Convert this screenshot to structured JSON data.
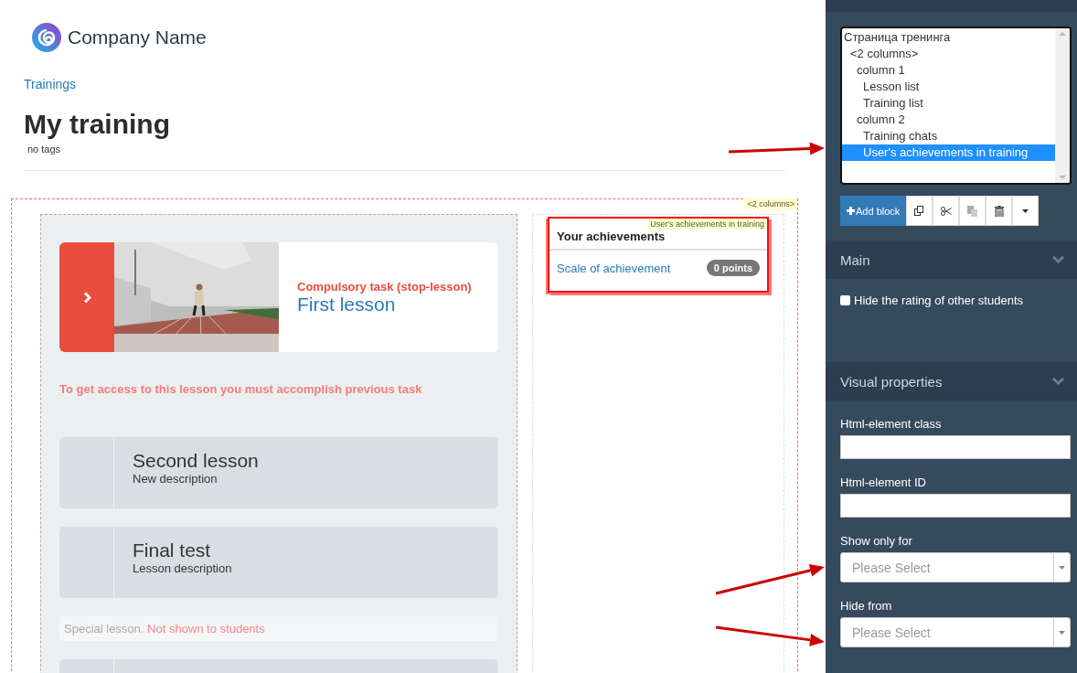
{
  "header": {
    "company": "Company Name",
    "breadcrumb": "Trainings",
    "title": "My training",
    "tags": "no tags"
  },
  "layout_tag": "<2 columns>",
  "column_1": {
    "featured": {
      "label": "Compulsory task (stop-lesson)",
      "title": "First lesson"
    },
    "notice": "To get access to this lesson you must accomplish previous task",
    "lessons": [
      {
        "kind": "card",
        "title": "Second lesson",
        "description": "New description"
      },
      {
        "kind": "card",
        "title": "Final test",
        "description": "Lesson description"
      },
      {
        "kind": "special",
        "text": "Special lesson.",
        "warning": "Not shown to students"
      },
      {
        "kind": "card"
      }
    ]
  },
  "column_2": {
    "widget": {
      "tag": "User's achievements in training",
      "title": "Your achievements",
      "link": "Scale of achievement",
      "badge": "0 points",
      "selected": true
    }
  },
  "sidebar": {
    "tree": [
      {
        "label": "Страница тренинга",
        "selected": false,
        "children": [
          {
            "label": "<2 columns>",
            "selected": false,
            "children": [
              {
                "label": "column 1",
                "selected": false,
                "children": [
                  {
                    "label": "Lesson list",
                    "selected": false
                  },
                  {
                    "label": "Training list",
                    "selected": false
                  }
                ]
              },
              {
                "label": "column 2",
                "selected": false,
                "children": [
                  {
                    "label": "Training chats",
                    "selected": false
                  },
                  {
                    "label": "User's achievements in training",
                    "selected": true
                  }
                ]
              }
            ]
          }
        ]
      }
    ],
    "toolbar": [
      {
        "kind": "add",
        "label": "Add block"
      },
      {
        "kind": "copy"
      },
      {
        "kind": "cut"
      },
      {
        "kind": "paste",
        "disabled": true
      },
      {
        "kind": "delete"
      },
      {
        "kind": "menu"
      }
    ],
    "sections": [
      {
        "title": "Main",
        "expanded": true,
        "fields": [
          {
            "kind": "checkbox",
            "label": "Hide the rating of other students",
            "checked": false
          }
        ]
      },
      {
        "title": "Visual properties",
        "expanded": true,
        "fields": [
          {
            "kind": "text",
            "label": "Html-element class"
          },
          {
            "kind": "text",
            "label": "Html-element ID"
          },
          {
            "kind": "select",
            "label": "Show only for",
            "placeholder": "Please Select"
          },
          {
            "kind": "select",
            "label": "Hide from",
            "placeholder": "Please Select"
          }
        ]
      }
    ]
  },
  "callouts": [
    {
      "kind": "arrow"
    },
    {
      "kind": "arrow"
    },
    {
      "kind": "arrow"
    }
  ]
}
